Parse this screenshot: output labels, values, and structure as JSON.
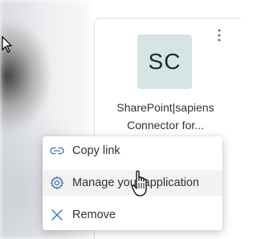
{
  "card": {
    "avatar_initials": "SC",
    "title_line1": "SharePoint|sapiens",
    "title_line2": "Connector for...",
    "more_icon": "more-vertical-icon"
  },
  "context_menu": {
    "items": [
      {
        "label": "Copy link",
        "icon": "link-icon"
      },
      {
        "label": "Manage your application",
        "icon": "gear-icon"
      },
      {
        "label": "Remove",
        "icon": "close-icon"
      }
    ]
  },
  "colors": {
    "avatar_bg": "#d6e4e6",
    "icon_blue": "#3a6fb0",
    "menu_hover": "#f3f2f1",
    "text": "#323130"
  }
}
